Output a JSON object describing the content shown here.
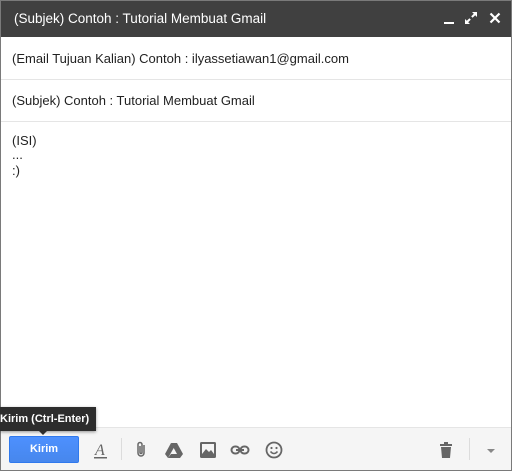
{
  "window": {
    "title": "(Subjek) Contoh : Tutorial Membuat Gmail",
    "icons": [
      "minimize-icon",
      "expand-icon",
      "close-icon"
    ]
  },
  "compose": {
    "to_value": "(Email Tujuan Kalian) Contoh : ilyassetiawan1@gmail.com",
    "subject_value": "(Subjek) Contoh : Tutorial Membuat Gmail",
    "body_lines": [
      "(ISI)",
      "...",
      ":)"
    ]
  },
  "toolbar": {
    "send_label": "Kirim",
    "send_tooltip": "Kirim (Ctrl-Enter)",
    "tools": [
      "formatting-icon",
      "attach-icon",
      "drive-icon",
      "photo-icon",
      "link-icon",
      "emoji-icon",
      "trash-icon",
      "more-options-icon"
    ]
  },
  "colors": {
    "titlebar": "#404040",
    "send_button": "#4d90fe",
    "toolbar_bg": "#f5f5f5",
    "tooltip_bg": "#2d2d2d"
  }
}
